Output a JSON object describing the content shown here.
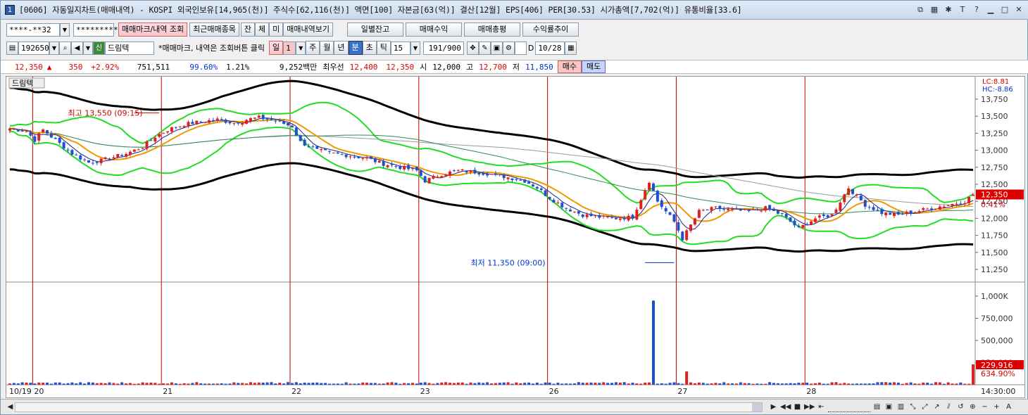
{
  "window": {
    "number": "1",
    "title": "[0606] 자동일지차트(매매내역) - KOSPI 외국인보유[14,965(천)] 주식수[62,116(천)] 액면[100] 자본금[63(억)] 결산[12월] EPS[406] PER[30.53] 시가총액[7,702(억)] 유통비율[33.6]"
  },
  "toolbar1": {
    "account": "****-**32",
    "password": "*********",
    "btn_mark": "매매마크/내역 조회",
    "btn_recent": "최근매매종목",
    "btn_jan": "잔",
    "btn_che": "체",
    "btn_mi": "미",
    "btn_history": "매매내역보기",
    "btn_daily": "일별잔고",
    "btn_profit": "매매수익",
    "btn_eval": "매매총평",
    "btn_trend": "수익률추이"
  },
  "toolbar2": {
    "code": "192650",
    "credit_badge": "신",
    "name": "드림텍",
    "note": "*매매마크, 내역은 조회버튼 클릭",
    "period_il": "일",
    "period_num": "1",
    "p_ju": "주",
    "p_wol": "월",
    "p_nyeon": "년",
    "p_bun": "분",
    "p_cho": "초",
    "p_tik": "틱",
    "interval": "15",
    "count": "191/900",
    "d_label": "D",
    "date": "10/28"
  },
  "quote": {
    "price": "12,350",
    "arrow": "▲",
    "change": "350",
    "pct": "+2.92%",
    "volume": "751,511",
    "vol_pct": "99.60%",
    "turnover": "1.21%",
    "amount": "9,252백만",
    "best_label": "최우선",
    "ask": "12,400",
    "bid": "12,350",
    "open_label": "시",
    "open": "12,000",
    "high_label": "고",
    "high": "12,700",
    "low_label": "저",
    "low": "11,850",
    "buy": "매수",
    "sell": "매도"
  },
  "colors": {
    "up": "#e02020",
    "down": "#2050d0",
    "bollinger": "#22dd22",
    "envelope": "#000000",
    "ma_orange": "#ee9900",
    "ma_navy": "#1a237e",
    "ma_green": "#2e8b57",
    "ma_gray": "#999999",
    "date_line": "#c00000"
  },
  "chart_data": {
    "type": "candlestick",
    "stock_label": "드림텍",
    "price_axis": {
      "min": 11250,
      "max": 13750,
      "ticks": [
        "13,750",
        "13,500",
        "13,250",
        "13,000",
        "12,750",
        "12,500",
        "12,250",
        "12,000",
        "11,750",
        "11,500",
        "11,250"
      ]
    },
    "volume_axis": {
      "min": 0,
      "max": 1000000,
      "ticks": [
        "1,000K",
        "750,000",
        "500,000",
        "250,000"
      ]
    },
    "dates": [
      {
        "label": "10/19",
        "bar": 0
      },
      {
        "label": "20",
        "bar": 6
      },
      {
        "label": "21",
        "bar": 37
      },
      {
        "label": "22",
        "bar": 68
      },
      {
        "label": "23",
        "bar": 99
      },
      {
        "label": "26",
        "bar": 130
      },
      {
        "label": "27",
        "bar": 161
      },
      {
        "label": "28",
        "bar": 192
      }
    ],
    "time_label": "14:30:00",
    "lc": "LC:8.81",
    "hc": "HC:-8.86",
    "last_price": "12,350",
    "last_pct": "0.41%",
    "last_volume": "229,916",
    "last_vol_pct": "634.90%",
    "annot_high": "최고 13,550 (09:15)",
    "annot_low": "최저 11,350 (09:00)",
    "price_path": [
      [
        0,
        13320
      ],
      [
        4,
        13280
      ],
      [
        6,
        13150
      ],
      [
        8,
        13300
      ],
      [
        12,
        13100
      ],
      [
        15,
        12950
      ],
      [
        19,
        12820
      ],
      [
        22,
        12850
      ],
      [
        25,
        12900
      ],
      [
        28,
        12950
      ],
      [
        32,
        13050
      ],
      [
        35,
        13200
      ],
      [
        38,
        13300
      ],
      [
        42,
        13380
      ],
      [
        46,
        13420
      ],
      [
        50,
        13450
      ],
      [
        54,
        13400
      ],
      [
        57,
        13450
      ],
      [
        60,
        13480
      ],
      [
        64,
        13430
      ],
      [
        68,
        13350
      ],
      [
        70,
        13120
      ],
      [
        74,
        13000
      ],
      [
        78,
        12950
      ],
      [
        82,
        12920
      ],
      [
        86,
        12880
      ],
      [
        90,
        12800
      ],
      [
        94,
        12750
      ],
      [
        98,
        12700
      ],
      [
        100,
        12550
      ],
      [
        104,
        12650
      ],
      [
        108,
        12700
      ],
      [
        112,
        12680
      ],
      [
        116,
        12650
      ],
      [
        120,
        12600
      ],
      [
        124,
        12550
      ],
      [
        127,
        12450
      ],
      [
        130,
        12300
      ],
      [
        134,
        12150
      ],
      [
        138,
        12050
      ],
      [
        142,
        12020
      ],
      [
        146,
        12000
      ],
      [
        150,
        12020
      ],
      [
        154,
        12550
      ],
      [
        156,
        12250
      ],
      [
        158,
        12100
      ],
      [
        160,
        11950
      ],
      [
        162,
        11700
      ],
      [
        164,
        11900
      ],
      [
        166,
        12100
      ],
      [
        170,
        12150
      ],
      [
        174,
        12120
      ],
      [
        178,
        12100
      ],
      [
        182,
        12150
      ],
      [
        186,
        12050
      ],
      [
        190,
        11850
      ],
      [
        194,
        12000
      ],
      [
        198,
        12050
      ],
      [
        202,
        12450
      ],
      [
        206,
        12200
      ],
      [
        210,
        12080
      ],
      [
        214,
        12050
      ],
      [
        218,
        12100
      ],
      [
        222,
        12150
      ],
      [
        226,
        12200
      ],
      [
        230,
        12250
      ],
      [
        232,
        12350
      ]
    ],
    "volume_spikes": [
      [
        155,
        950000
      ],
      [
        163,
        150000
      ],
      [
        232,
        229916
      ]
    ],
    "volume_base": 20000
  },
  "status": {
    "play": "▶",
    "stop": "■",
    "prev": "◀◀",
    "next": "▶▶"
  }
}
